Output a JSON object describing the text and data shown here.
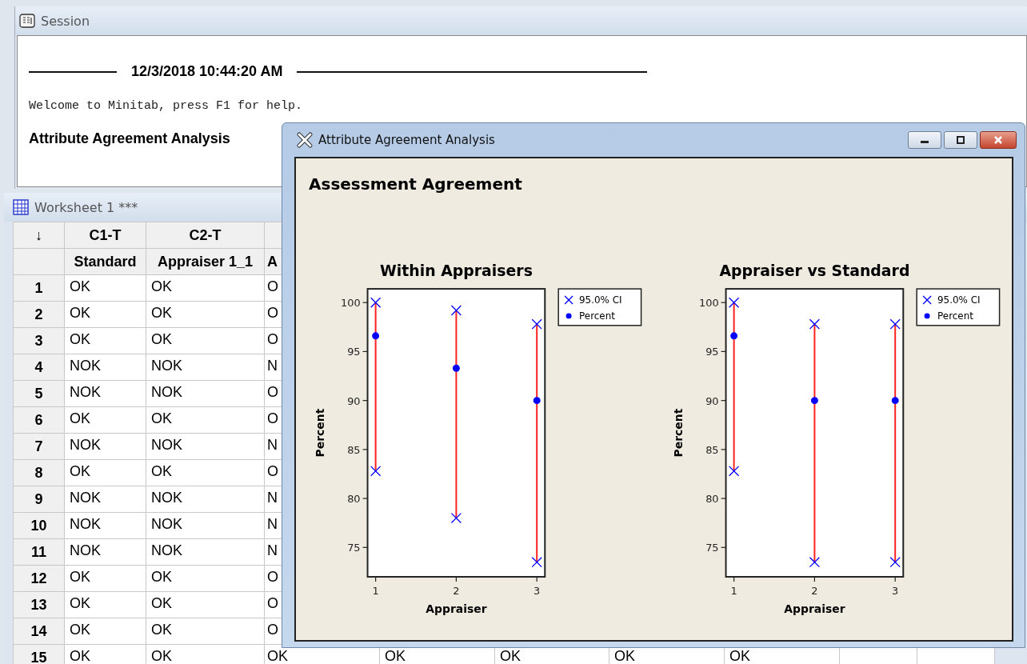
{
  "session": {
    "title": "Session",
    "timestamp": "12/3/2018 10:44:20 AM",
    "welcome": "Welcome to Minitab, press F1 for help.",
    "heading": "Attribute Agreement Analysis"
  },
  "worksheet": {
    "title": "Worksheet 1 ***",
    "corner": "↓",
    "columns": [
      {
        "header": "C1-T",
        "name": "Standard"
      },
      {
        "header": "C2-T",
        "name": "Appraiser 1_1"
      },
      {
        "name": "A"
      }
    ],
    "rows": [
      {
        "index": "1",
        "cells": [
          "OK",
          "OK",
          "O"
        ]
      },
      {
        "index": "2",
        "cells": [
          "OK",
          "OK",
          "O"
        ]
      },
      {
        "index": "3",
        "cells": [
          "OK",
          "OK",
          "O"
        ]
      },
      {
        "index": "4",
        "cells": [
          "NOK",
          "NOK",
          "N"
        ]
      },
      {
        "index": "5",
        "cells": [
          "NOK",
          "NOK",
          "O"
        ]
      },
      {
        "index": "6",
        "cells": [
          "OK",
          "OK",
          "O"
        ]
      },
      {
        "index": "7",
        "cells": [
          "NOK",
          "NOK",
          "N"
        ]
      },
      {
        "index": "8",
        "cells": [
          "OK",
          "OK",
          "O"
        ]
      },
      {
        "index": "9",
        "cells": [
          "NOK",
          "NOK",
          "N"
        ]
      },
      {
        "index": "10",
        "cells": [
          "NOK",
          "NOK",
          "N"
        ]
      },
      {
        "index": "11",
        "cells": [
          "NOK",
          "NOK",
          "N"
        ]
      },
      {
        "index": "12",
        "cells": [
          "OK",
          "OK",
          "O"
        ]
      },
      {
        "index": "13",
        "cells": [
          "OK",
          "OK",
          "O"
        ]
      },
      {
        "index": "14",
        "cells": [
          "OK",
          "OK",
          "O"
        ]
      },
      {
        "index": "15",
        "cells": [
          "OK",
          "OK",
          "OK",
          "OK",
          "OK",
          "OK",
          "OK"
        ]
      }
    ]
  },
  "dialog": {
    "title": "Attribute Agreement Analysis",
    "heading": "Assessment Agreement",
    "charts": [
      {
        "chart_data": {
          "type": "scatter",
          "title": "Within Appraisers",
          "xlabel": "Appraiser",
          "ylabel": "Percent",
          "categories": [
            "1",
            "2",
            "3"
          ],
          "ylim": [
            72,
            101.4
          ],
          "yticks": [
            75,
            80,
            85,
            90,
            95,
            100
          ],
          "legend": "right",
          "series": [
            {
              "name": "95.0% CI",
              "color": "#0000ff",
              "values": [
                100,
                99.2,
                97.8
              ]
            },
            {
              "color": "#0000ff",
              "values": [
                82.8,
                78,
                73.5
              ]
            },
            {
              "name": "Percent",
              "color": "#0000ff",
              "values": [
                96.6,
                93.3,
                90
              ]
            }
          ]
        }
      },
      {
        "chart_data": {
          "type": "scatter",
          "title": "Appraiser vs Standard",
          "xlabel": "Appraiser",
          "ylabel": "Percent",
          "categories": [
            "1",
            "2",
            "3"
          ],
          "ylim": [
            72,
            101.4
          ],
          "yticks": [
            75,
            80,
            85,
            90,
            95,
            100
          ],
          "legend": "right",
          "series": [
            {
              "name": "95.0% CI",
              "color": "#0000ff",
              "values": [
                100,
                97.8,
                97.8
              ]
            },
            {
              "color": "#0000ff",
              "values": [
                82.8,
                73.5,
                73.5
              ]
            },
            {
              "name": "Percent",
              "color": "#0000ff",
              "values": [
                96.6,
                90,
                90
              ]
            }
          ]
        }
      }
    ]
  }
}
